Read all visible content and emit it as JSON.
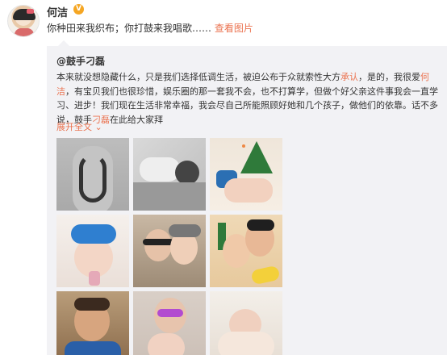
{
  "post": {
    "username": "何洁",
    "badge": "V",
    "text": "你种田来我织布；你打鼓来我唱歌……",
    "see_pictures": "查看图片"
  },
  "repost": {
    "author": "@鼓手刁磊",
    "body_1": "本来就没想隐藏什么，只是我们选择低调生活，被迫公布于众就索性大方",
    "hl_1": "承认",
    "body_2": "，是的，我很爱",
    "hl_2": "何洁",
    "body_3": "，有宝贝我们也很珍惜，娱乐圈的那一套我不会，也不打算学，但做个好父亲这件事我会一直学习、进步！我们现在生活非常幸福，我会尽自己所能照顾好她和几个孩子，做他们的依靠。话不多说，鼓手",
    "hl_3": "刁磊",
    "body_4": "在此给大家拜",
    "expand": "展开全文"
  },
  "images": [
    {
      "desc": "tattooed back"
    },
    {
      "desc": "father and baby sleeping"
    },
    {
      "desc": "baby with christmas tree"
    },
    {
      "desc": "baby with blue bow"
    },
    {
      "desc": "couple selfie"
    },
    {
      "desc": "kiss with wow sticker"
    },
    {
      "desc": "boy portrait"
    },
    {
      "desc": "mother and newborn"
    },
    {
      "desc": "newborn on blanket"
    }
  ],
  "colors": {
    "accent": "#eb7350",
    "repost_bg": "#f2f2f5",
    "text": "#333333"
  }
}
